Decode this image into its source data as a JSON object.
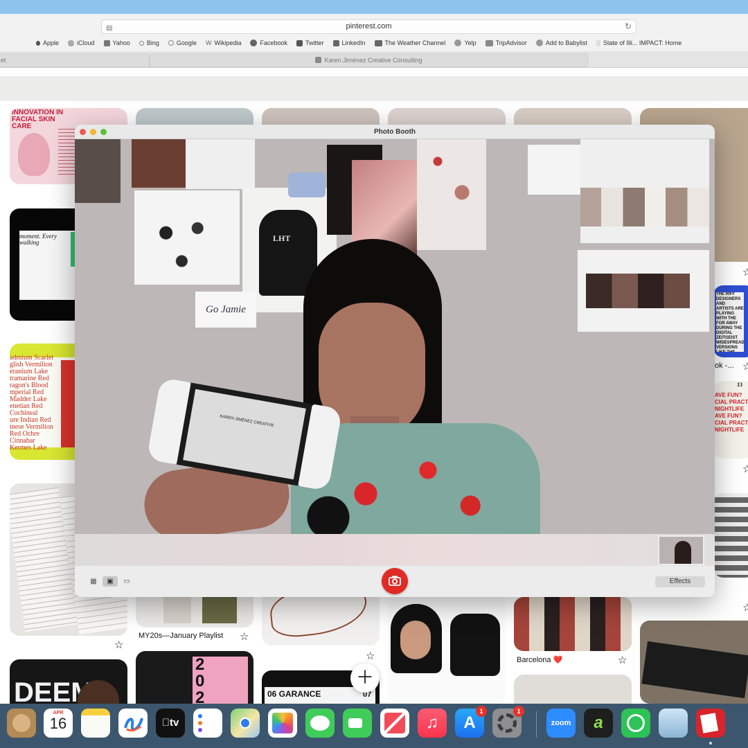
{
  "browser": {
    "url": "pinterest.com",
    "favorites": [
      "Apple",
      "iCloud",
      "Yahoo",
      "Bing",
      "Google",
      "Wikipedia",
      "Facebook",
      "Twitter",
      "LinkedIn",
      "The Weather Channel",
      "Yelp",
      "TripAdvisor",
      "Add to Babylist",
      "State of Illi... IMPACT: Home"
    ],
    "tabs": {
      "left": "et",
      "active": "Karen Jiménez Creative Consulting"
    }
  },
  "pins": {
    "skin_care_title": "INNOVATION IN FACIAL SKIN CARE",
    "walking_moment": "moment. Every walking",
    "pigments": [
      "admium Scarlet",
      "glish Vermilion",
      "eranium Lake",
      "tramarine Red",
      "ragon's Blood",
      "mperial Red",
      "Madder Lake",
      "enetian Red",
      "Cochineal",
      "ure Indian Red",
      "inese Vermilion",
      "Red Ochre",
      "Cinnabar",
      "Kermes Lake"
    ],
    "my20s": "MY20s—January Playlist",
    "barcelona": "Barcelona ❤️",
    "garance": "06 GARANCE",
    "garance_num": "07",
    "deem": "DEEM",
    "year_digits": "202",
    "ok_caption": "ok -...",
    "fun_poster": [
      "AVE FUN?",
      "CIAL PRACTICE",
      "NIGHTLIFE",
      "AVE FUN?",
      "CIAL PRACTICE",
      "NIGHTLIFE"
    ],
    "fun_poster_top": [
      "13",
      "ART",
      "ART"
    ],
    "riff_text": "THE RIFF DESIGNERS AND ARTISTS ARE PLAYING WITH THE FOR AWAY DURING THE DIGITAL ZEITGEIST WIDESPREAD VERSIONS LIKE THE BEFORE. SHE'S A WOMAN WHO STYLE HERSELF",
    "handwriting": "Go Jamie",
    "hoodie_text": "LHT"
  },
  "photobooth": {
    "title": "Photo Booth",
    "effects_label": "Effects",
    "switch_screen": "KAREN JIMÉNEZ CREATIVE"
  },
  "dock": {
    "calendar_month": "APR",
    "calendar_day": "16",
    "tv_label": "tv",
    "zoom_label": "zoom",
    "app_store_badge": "1",
    "settings_badge": "1"
  },
  "colors": {
    "shutter": "#e02a25",
    "dock": "#3c566e",
    "pinterest_bg": "#ffffff"
  }
}
